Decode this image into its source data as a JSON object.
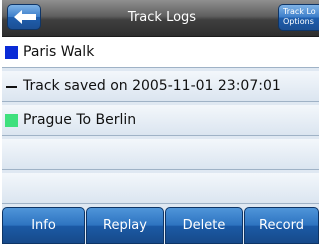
{
  "header": {
    "title": "Track Logs",
    "options_label": "Track Lo\nOptions"
  },
  "tracks": [
    {
      "label": "Paris Walk",
      "marker": "swatch",
      "color": "#0a2bd6"
    },
    {
      "label": "Track saved on 2005-11-01 23:07:01",
      "marker": "dash",
      "color": "#111111"
    },
    {
      "label": "Prague To Berlin",
      "marker": "swatch",
      "color": "#3ee07d"
    },
    {
      "label": "",
      "marker": "none",
      "color": ""
    },
    {
      "label": "",
      "marker": "none",
      "color": ""
    }
  ],
  "toolbar": {
    "info_label": "Info",
    "replay_label": "Replay",
    "delete_label": "Delete",
    "record_label": "Record"
  },
  "icons": {
    "back": "arrow-left-icon"
  }
}
